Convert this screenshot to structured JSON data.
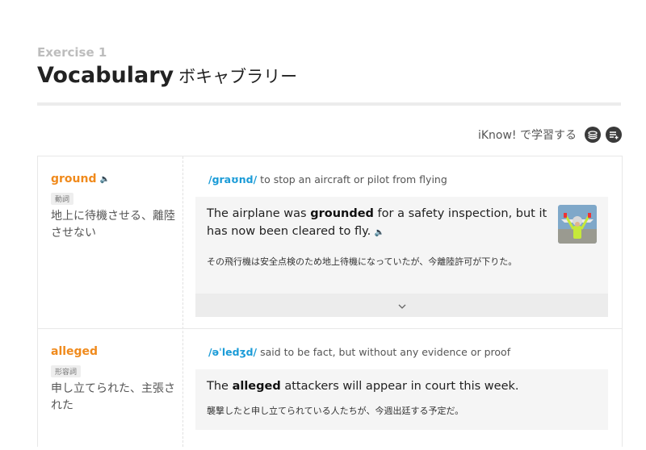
{
  "header": {
    "exercise_label": "Exercise 1",
    "title": "Vocabulary",
    "title_jp": "ボキャブラリー"
  },
  "iknow": {
    "label": "iKnow! で学習する",
    "icons": [
      "iknow-stack-icon",
      "add-list-icon"
    ]
  },
  "entries": [
    {
      "word": "ground",
      "part_of_speech": "動詞",
      "meaning_jp": "地上に待機させる、離陸させない",
      "pronunciation": "/graʊnd/",
      "definition": "to stop an aircraft or pilot from flying",
      "example_en_before": "The airplane was ",
      "example_en_bold": "grounded",
      "example_en_after": " for a safety inspection, but it has now been cleared to fly.",
      "example_jp": "その飛行機は安全点検のため地上待機になっていたが、今離陸許可が下りた。",
      "has_image": true
    },
    {
      "word": "alleged",
      "part_of_speech": "形容詞",
      "meaning_jp": "申し立てられた、主張された",
      "pronunciation": "/əˈledʒd/",
      "definition": "said to be fact, but without any evidence or proof",
      "example_en_before": "The ",
      "example_en_bold": "alleged",
      "example_en_after": " attackers will appear in court this week.",
      "example_jp": "襲撃したと申し立てられている人たちが、今週出廷する予定だ。"
    }
  ],
  "colors": {
    "word": "#f08a1c",
    "pronunciation": "#1a9bd7",
    "example_bg": "#f5f5f5"
  }
}
